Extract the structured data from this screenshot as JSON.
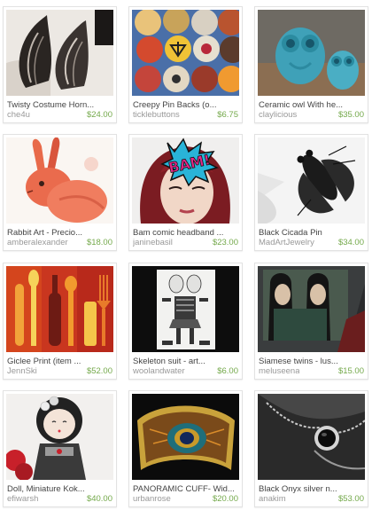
{
  "items": [
    {
      "title": "Twisty Costume Horn...",
      "shop": "che4u",
      "price": "$24.00",
      "image": "horns-photo"
    },
    {
      "title": "Creepy Pin Backs (o...",
      "shop": "ticklebuttons",
      "price": "$6.75",
      "image": "pin-badges-photo"
    },
    {
      "title": "Ceramic owl With he...",
      "shop": "claylicious",
      "price": "$35.00",
      "image": "ceramic-owls-photo"
    },
    {
      "title": "Rabbit Art - Precio...",
      "shop": "amberalexander",
      "price": "$18.00",
      "image": "rabbit-painting"
    },
    {
      "title": "Bam comic headband ...",
      "shop": "janinebasil",
      "price": "$23.00",
      "image": "bam-headband-photo"
    },
    {
      "title": "Black Cicada Pin",
      "shop": "MadArtJewelry",
      "price": "$34.00",
      "image": "cicada-pin-photo"
    },
    {
      "title": "Giclee Print (item ...",
      "shop": "JennSki",
      "price": "$52.00",
      "image": "kitchen-print"
    },
    {
      "title": "Skeleton suit - art...",
      "shop": "woolandwater",
      "price": "$6.00",
      "image": "skeleton-paper-doll"
    },
    {
      "title": "Siamese twins - lus...",
      "shop": "meluseena",
      "price": "$15.00",
      "image": "siamese-twins-print"
    },
    {
      "title": "Doll, Miniature Kok...",
      "shop": "efiwarsh",
      "price": "$40.00",
      "image": "kokeshi-doll-photo"
    },
    {
      "title": "PANORAMIC CUFF- Wid...",
      "shop": "urbanrose",
      "price": "$20.00",
      "image": "peacock-cuff-photo"
    },
    {
      "title": "Black Onyx silver n...",
      "shop": "anakim",
      "price": "$53.00",
      "image": "onyx-necklace-photo"
    }
  ]
}
